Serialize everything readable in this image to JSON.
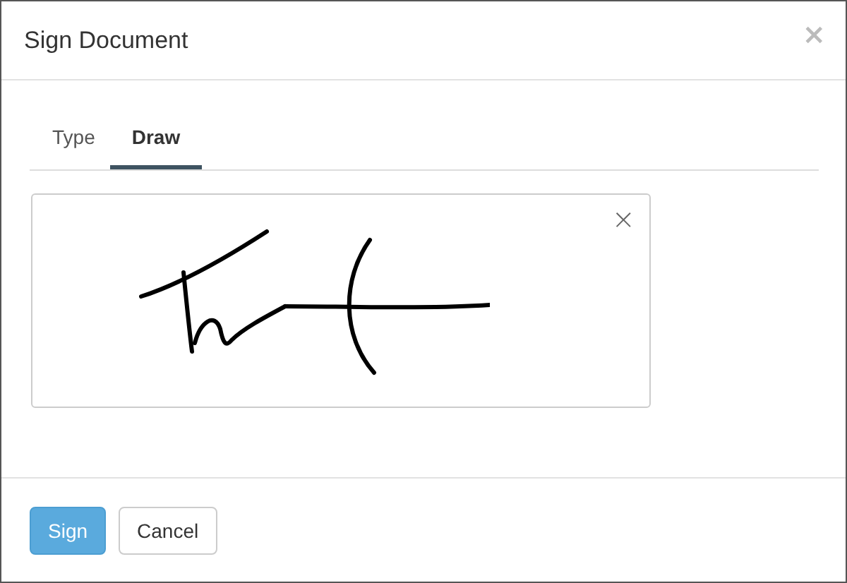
{
  "dialog": {
    "title": "Sign Document",
    "close": "×"
  },
  "tabs": [
    {
      "label": "Type",
      "selected": false
    },
    {
      "label": "Draw",
      "selected": true
    }
  ],
  "pad": {
    "clear": "×"
  },
  "buttons": [
    {
      "label": "Sign",
      "kind": "primary"
    },
    {
      "label": "Cancel",
      "kind": "default"
    }
  ]
}
